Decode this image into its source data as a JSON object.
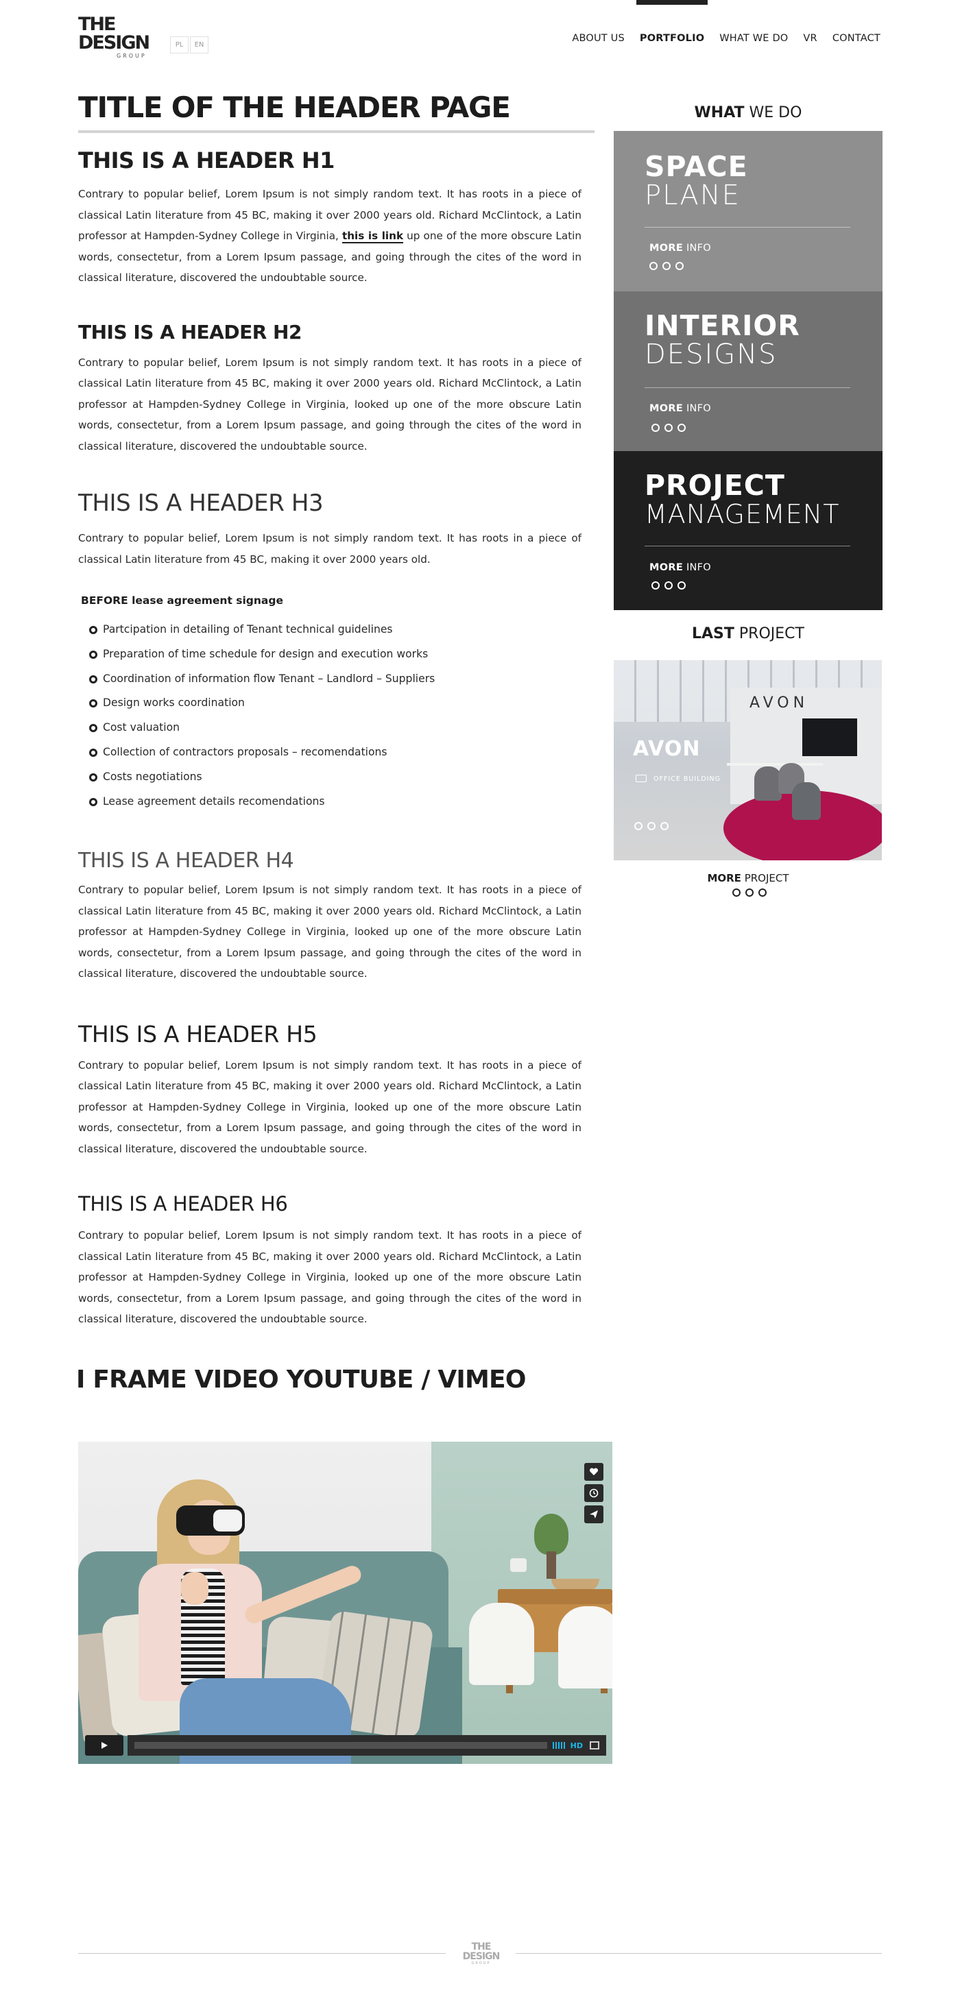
{
  "header": {
    "logo": {
      "line1": "THE",
      "line2": "DESIGN",
      "line3": "GROUP"
    },
    "languages": [
      "PL",
      "EN"
    ],
    "nav": [
      "ABOUT US",
      "PORTFOLIO",
      "WHAT WE DO",
      "VR",
      "CONTACT"
    ],
    "active_nav": "PORTFOLIO"
  },
  "main": {
    "page_title": "TITLE OF THE HEADER PAGE",
    "h1": "THIS IS A HEADER H1",
    "p1_before_link": "Contrary to popular belief, Lorem Ipsum is not simply random text. It has roots in a piece of classical Latin literature from 45 BC, making it over 2000 years old. Richard McClintock, a Latin professor at Hampden-Sydney College in Virginia, ",
    "p1_link": "this is link",
    "p1_after_link": " up one of the more obscure Latin words, consectetur, from a Lorem Ipsum passage, and going through the cites of the word in classical literature, discovered the undoubtable source.",
    "h2": "THIS IS A HEADER H2",
    "p2": "Contrary to popular belief, Lorem Ipsum is not simply random text. It has roots in a piece of classical Latin literature from 45 BC, making it over 2000 years old. Richard McClintock, a Latin professor at Hampden-Sydney College in Virginia, looked up one of the more obscure Latin words, consectetur, from a Lorem Ipsum passage, and going through the cites of the word in classical literature, discovered the undoubtable source.",
    "h3": "THIS IS A HEADER H3",
    "p3": "Contrary to popular belief, Lorem Ipsum is not simply random text. It has roots in a piece of classical Latin literature from 45 BC, making it over 2000 years old.",
    "list_title_bold": "BEFORE",
    "list_title_rest": "lease agreement signage",
    "list_items": [
      "Partcipation in detailing of Tenant technical guidelines",
      "Preparation of time schedule for design and execution works",
      "Coordination of information flow Tenant – Landlord – Suppliers",
      "Design works coordination",
      "Cost valuation",
      "Collection of contractors proposals – recomendations",
      "Costs negotiations",
      "Lease agreement details recomendations"
    ],
    "h4": "THIS IS A HEADER H4",
    "p4": "Contrary to popular belief, Lorem Ipsum is not simply random text. It has roots in a piece of classical Latin literature from 45 BC, making it over 2000 years old. Richard McClintock, a Latin professor at Hampden-Sydney College in Virginia, looked up one of the more obscure Latin words, consectetur, from a Lorem Ipsum passage, and going through the cites of the word in classical literature, discovered the undoubtable source.",
    "h5": "THIS IS A HEADER H5",
    "p5": "Contrary to popular belief, Lorem Ipsum is not simply random text. It has roots in a piece of classical Latin literature from 45 BC, making it over 2000 years old. Richard McClintock, a Latin professor at Hampden-Sydney College in Virginia, looked up one of the more obscure Latin words, consectetur, from a Lorem Ipsum passage, and going through the cites of the word in classical literature, discovered the undoubtable source.",
    "h6": "THIS IS A HEADER H6",
    "p6": "Contrary to popular belief, Lorem Ipsum is not simply random text. It has roots in a piece of classical Latin literature from 45 BC, making it over 2000 years old. Richard McClintock, a Latin professor at Hampden-Sydney College in Virginia, looked up one of the more obscure Latin words, consectetur, from a Lorem Ipsum passage, and going through the cites of the word in classical literature, discovered the undoubtable source.",
    "iframe_title": "I FRAME VIDEO YOUTUBE / VIMEO",
    "video": {
      "hd_label": "HD",
      "icons": [
        "heart-icon",
        "clock-icon",
        "send-icon"
      ]
    }
  },
  "sidebar": {
    "what_we_do_bold": "WHAT",
    "what_we_do_rest": " WE DO",
    "tiles": [
      {
        "line1": "SPACE",
        "line2": "PLANE",
        "more_bold": "MORE",
        "more_rest": " INFO",
        "color": "#8f8f8f"
      },
      {
        "line1": "INTERIOR",
        "line2": "DESIGNS",
        "more_bold": "MORE",
        "more_rest": " INFO",
        "color": "#727272"
      },
      {
        "line1": "PROJECT",
        "line2": "MANAGEMENT",
        "more_bold": "MORE",
        "more_rest": " INFO",
        "color": "#1f1f1f"
      }
    ],
    "last_project_bold": "LAST",
    "last_project_rest": " PROJECT",
    "project": {
      "name": "AVON",
      "category": "OFFICE BUILDING",
      "wall_text": "AVON"
    },
    "more_project_bold": "MORE",
    "more_project_rest": " PROJECT"
  },
  "footer": {
    "logo_line1": "THE",
    "logo_line2": "DESIGN",
    "logo_line3": "GROUP"
  },
  "colors": {
    "text": "#1e1e1e",
    "tile_light": "#8f8f8f",
    "tile_mid": "#727272",
    "tile_dark": "#1f1f1f",
    "video_accent": "#19b7ea",
    "rug": "#b0124e"
  }
}
